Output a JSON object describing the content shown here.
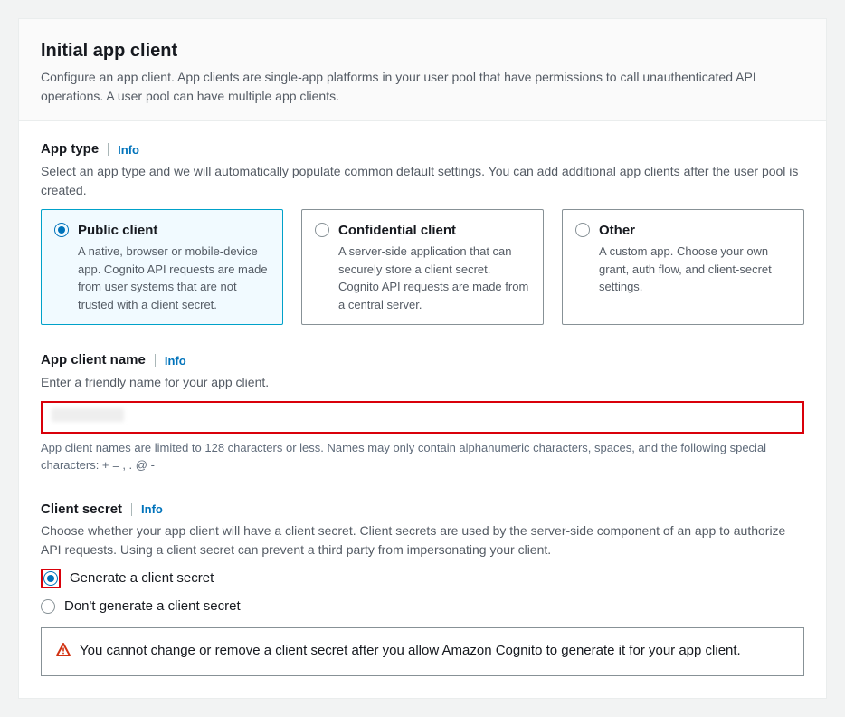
{
  "header": {
    "title": "Initial app client",
    "description": "Configure an app client. App clients are single-app platforms in your user pool that have permissions to call unauthenticated API operations. A user pool can have multiple app clients."
  },
  "info_label": "Info",
  "app_type": {
    "label": "App type",
    "description": "Select an app type and we will automatically populate common default settings. You can add additional app clients after the user pool is created.",
    "options": [
      {
        "title": "Public client",
        "desc": "A native, browser or mobile-device app. Cognito API requests are made from user systems that are not trusted with a client secret."
      },
      {
        "title": "Confidential client",
        "desc": "A server-side application that can securely store a client secret. Cognito API requests are made from a central server."
      },
      {
        "title": "Other",
        "desc": "A custom app. Choose your own grant, auth flow, and client-secret settings."
      }
    ]
  },
  "client_name": {
    "label": "App client name",
    "description": "Enter a friendly name for your app client.",
    "value": "",
    "hint": "App client names are limited to 128 characters or less. Names may only contain alphanumeric characters, spaces, and the following special characters: + = , . @ -"
  },
  "client_secret": {
    "label": "Client secret",
    "description": "Choose whether your app client will have a client secret. Client secrets are used by the server-side component of an app to authorize API requests. Using a client secret can prevent a third party from impersonating your client.",
    "options": [
      "Generate a client secret",
      "Don't generate a client secret"
    ],
    "warning": "You cannot change or remove a client secret after you allow Amazon Cognito to generate it for your app client."
  }
}
